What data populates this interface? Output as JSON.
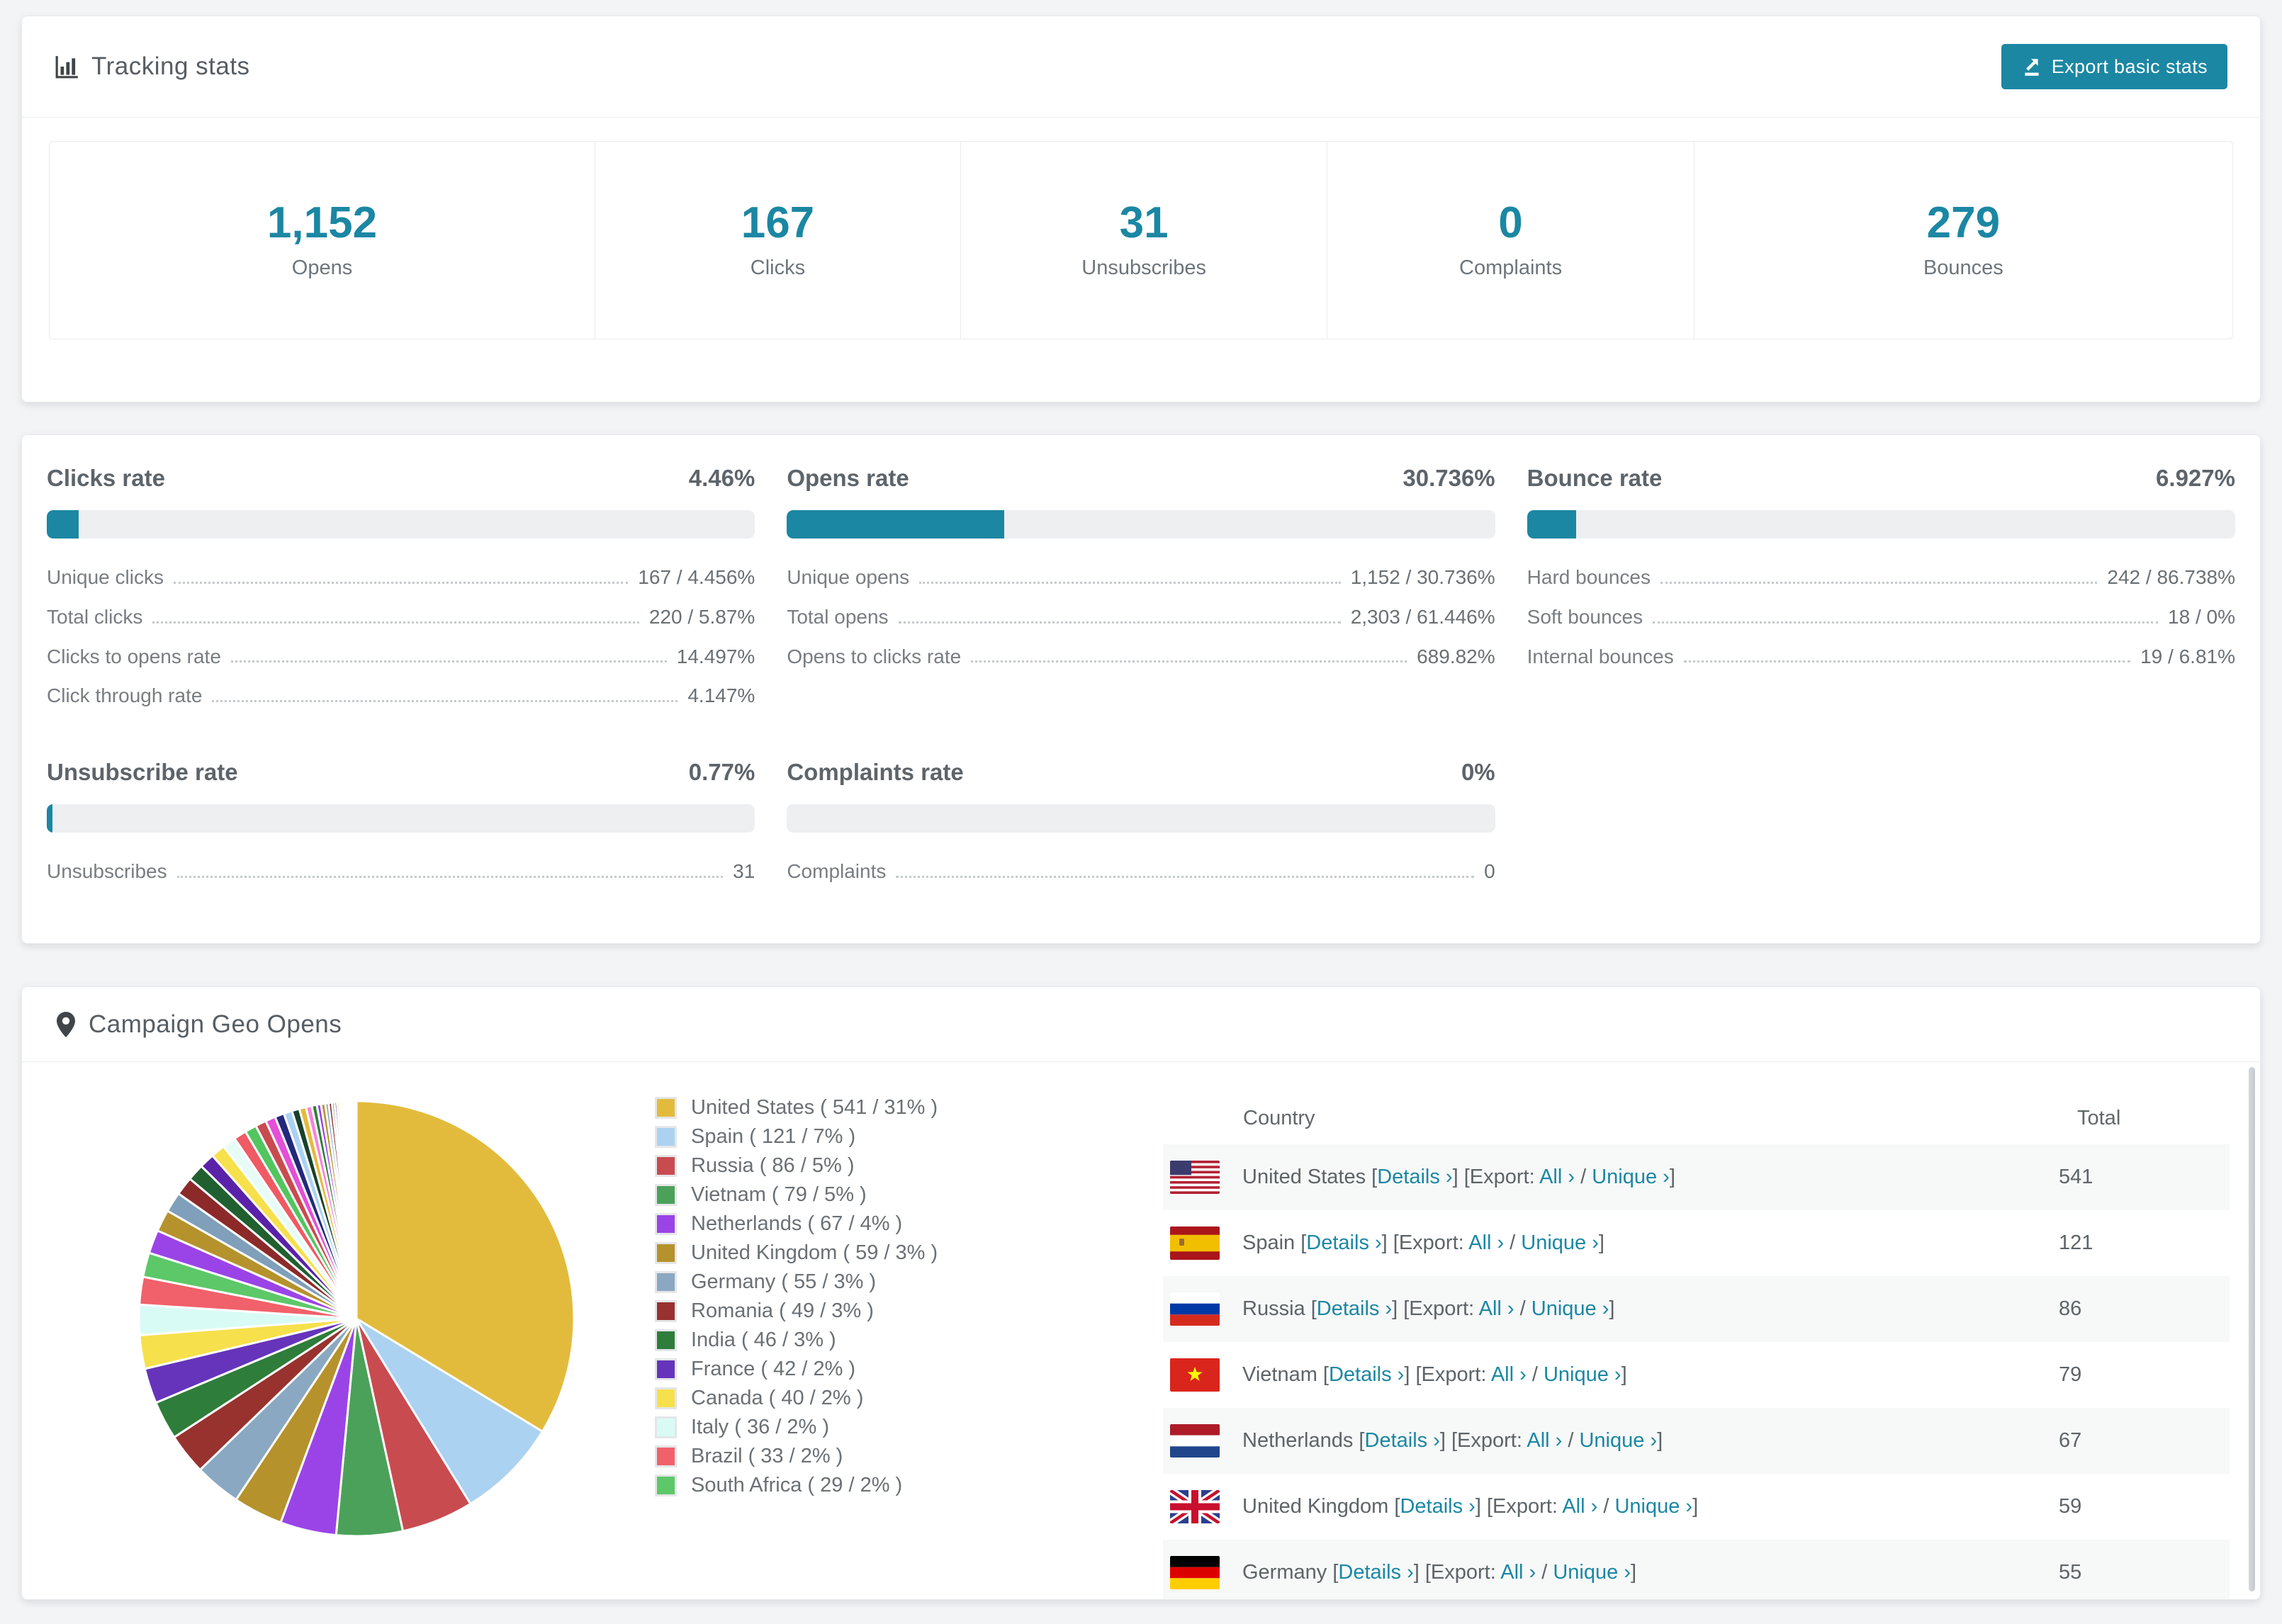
{
  "accent": "#1b87a3",
  "header": {
    "title": "Tracking stats",
    "icon": "bar-chart-icon",
    "export_label": "Export basic stats"
  },
  "stats": [
    {
      "value": "1,152",
      "label": "Opens"
    },
    {
      "value": "167",
      "label": "Clicks"
    },
    {
      "value": "31",
      "label": "Unsubscribes"
    },
    {
      "value": "0",
      "label": "Complaints"
    },
    {
      "value": "279",
      "label": "Bounces"
    }
  ],
  "rates": {
    "top": [
      {
        "title": "Clicks rate",
        "value": "4.46%",
        "percent": 4.46,
        "rows": [
          {
            "label": "Unique clicks",
            "value": "167 / 4.456%"
          },
          {
            "label": "Total clicks",
            "value": "220 / 5.87%"
          },
          {
            "label": "Clicks to opens rate",
            "value": "14.497%"
          },
          {
            "label": "Click through rate",
            "value": "4.147%"
          }
        ]
      },
      {
        "title": "Opens rate",
        "value": "30.736%",
        "percent": 30.736,
        "rows": [
          {
            "label": "Unique opens",
            "value": "1,152 / 30.736%"
          },
          {
            "label": "Total opens",
            "value": "2,303 / 61.446%"
          },
          {
            "label": "Opens to clicks rate",
            "value": "689.82%"
          }
        ]
      },
      {
        "title": "Bounce rate",
        "value": "6.927%",
        "percent": 6.927,
        "rows": [
          {
            "label": "Hard bounces",
            "value": "242 / 86.738%"
          },
          {
            "label": "Soft bounces",
            "value": "18 / 0%"
          },
          {
            "label": "Internal bounces",
            "value": "19 / 6.81%"
          }
        ]
      }
    ],
    "bottom": [
      {
        "title": "Unsubscribe rate",
        "value": "0.77%",
        "percent": 0.77,
        "rows": [
          {
            "label": "Unsubscribes",
            "value": "31"
          }
        ]
      },
      {
        "title": "Complaints rate",
        "value": "0%",
        "percent": 0,
        "rows": [
          {
            "label": "Complaints",
            "value": "0"
          }
        ]
      }
    ]
  },
  "geo": {
    "title": "Campaign Geo Opens",
    "icon": "map-pin-icon",
    "table": {
      "columns": [
        "Country",
        "Total"
      ],
      "links": {
        "details": "Details",
        "export_prefix": "Export:",
        "all": "All",
        "unique": "Unique",
        "chevron": "›"
      },
      "rows": [
        {
          "country": "United States",
          "flag": "us",
          "total": "541"
        },
        {
          "country": "Spain",
          "flag": "es",
          "total": "121"
        },
        {
          "country": "Russia",
          "flag": "ru",
          "total": "86"
        },
        {
          "country": "Vietnam",
          "flag": "vn",
          "total": "79"
        },
        {
          "country": "Netherlands",
          "flag": "nl",
          "total": "67"
        },
        {
          "country": "United Kingdom",
          "flag": "gb",
          "total": "59"
        },
        {
          "country": "Germany",
          "flag": "de",
          "total": "55"
        }
      ]
    }
  },
  "chart_data": {
    "type": "pie",
    "title": "Campaign Geo Opens",
    "legend_position": "right",
    "legend_format": "{label} ( {value} / {percent}% )",
    "labels": [
      "United States",
      "Spain",
      "Russia",
      "Vietnam",
      "Netherlands",
      "United Kingdom",
      "Germany",
      "Romania",
      "India",
      "France",
      "Canada",
      "Italy",
      "Brazil",
      "South Africa"
    ],
    "values": [
      541,
      121,
      86,
      79,
      67,
      59,
      55,
      49,
      46,
      42,
      40,
      36,
      33,
      29
    ],
    "percents": [
      31,
      7,
      5,
      5,
      4,
      3,
      3,
      3,
      3,
      2,
      2,
      2,
      2,
      2
    ],
    "colors": [
      "#e3bb3c",
      "#abd2f1",
      "#c84b50",
      "#4ba159",
      "#9a44e8",
      "#b5922c",
      "#8aa8c1",
      "#97322f",
      "#2e7d3a",
      "#6534bb",
      "#f6e04b",
      "#d9fbf5",
      "#f0616b",
      "#5cc868"
    ],
    "tail_values": [
      28,
      26,
      24,
      22,
      20,
      18,
      17,
      16,
      15,
      14,
      13,
      12,
      11,
      10,
      9,
      8,
      7,
      6,
      5,
      5,
      4,
      4,
      3,
      3,
      3,
      2,
      2,
      2,
      2,
      1.8,
      1.6,
      1.4,
      1.2,
      1,
      0.9,
      0.8,
      0.7,
      0.6,
      0.5,
      0.4,
      0.35,
      0.3,
      0.25,
      0.2
    ],
    "tail_colors": [
      "#9a44e8",
      "#b5922c",
      "#7f9fba",
      "#8c2a2a",
      "#206030",
      "#5a22a8",
      "#f6e04b",
      "#e7fbf7",
      "#ef5a64",
      "#52c55f",
      "#c84b50",
      "#e44fd7",
      "#23297a",
      "#abd2f1",
      "#19412a",
      "#e3bb3c",
      "#f783d9",
      "#2e7d3a"
    ]
  }
}
